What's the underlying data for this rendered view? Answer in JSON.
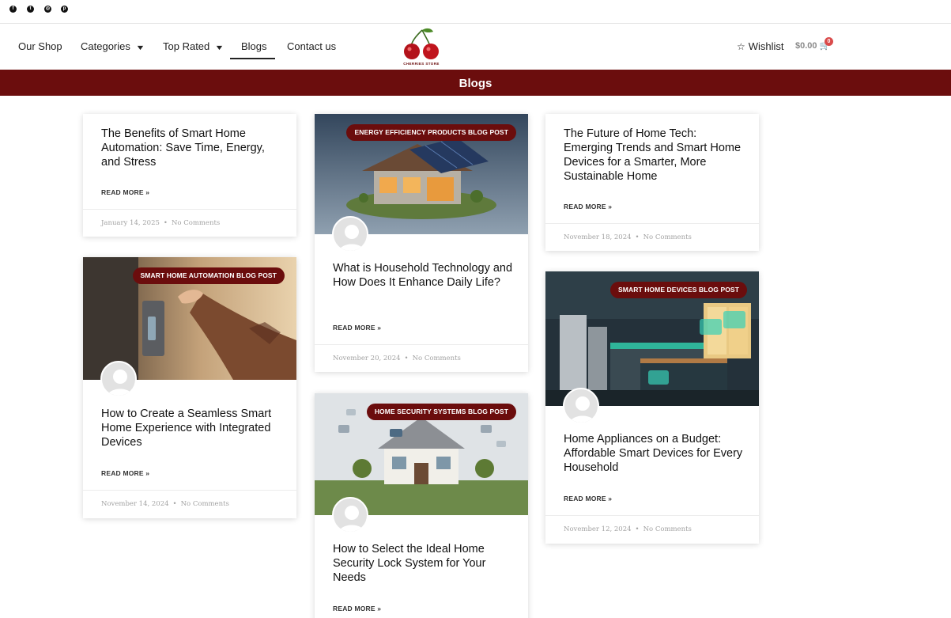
{
  "social": {
    "icons": [
      "facebook-icon",
      "twitter-icon",
      "instagram-icon",
      "pinterest-icon"
    ],
    "glyphs": [
      "f",
      "t",
      "◎",
      "p"
    ]
  },
  "nav": {
    "our_shop": "Our Shop",
    "categories": "Categories",
    "top_rated": "Top Rated",
    "blogs": "Blogs",
    "contact_us": "Contact us",
    "chevron": "⌄"
  },
  "logo": {
    "text": "CHERRIES STORE"
  },
  "header_right": {
    "wishlist": "Wishlist",
    "cart_total": "$0.00",
    "cart_count": "0"
  },
  "banner": {
    "title": "Blogs"
  },
  "colors": {
    "brand": "#6b0d0d",
    "badge_bg": "#6b0d0d",
    "cart_badge": "#d94b4b"
  },
  "posts": [
    {
      "title": "The Benefits of Smart Home Automation: Save Time, Energy, and Stress",
      "read_more": "READ MORE »",
      "date": "January 14, 2025",
      "comments": "No Comments"
    },
    {
      "title": "How to Create a Seamless Smart Home Experience with Integrated Devices",
      "category": "SMART HOME AUTOMATION BLOG POST",
      "read_more": "READ MORE »",
      "date": "November 14, 2024",
      "comments": "No Comments"
    },
    {
      "title": "What is Household Technology and How Does It Enhance Daily Life?",
      "category": "ENERGY EFFICIENCY PRODUCTS BLOG POST",
      "read_more": "READ MORE »",
      "date": "November 20, 2024",
      "comments": "No Comments"
    },
    {
      "title": "How to Select the Ideal Home Security Lock System for Your Needs",
      "category": "HOME SECURITY SYSTEMS BLOG POST",
      "read_more": "READ MORE »"
    },
    {
      "title": "The Future of Home Tech: Emerging Trends and Smart Home Devices for a Smarter, More Sustainable Home",
      "read_more": "READ MORE »",
      "date": "November 18, 2024",
      "comments": "No Comments"
    },
    {
      "title": "Home Appliances on a Budget: Affordable Smart Devices for Every Household",
      "category": "SMART HOME DEVICES BLOG POST",
      "read_more": "READ MORE »",
      "date": "November 12, 2024",
      "comments": "No Comments"
    }
  ]
}
